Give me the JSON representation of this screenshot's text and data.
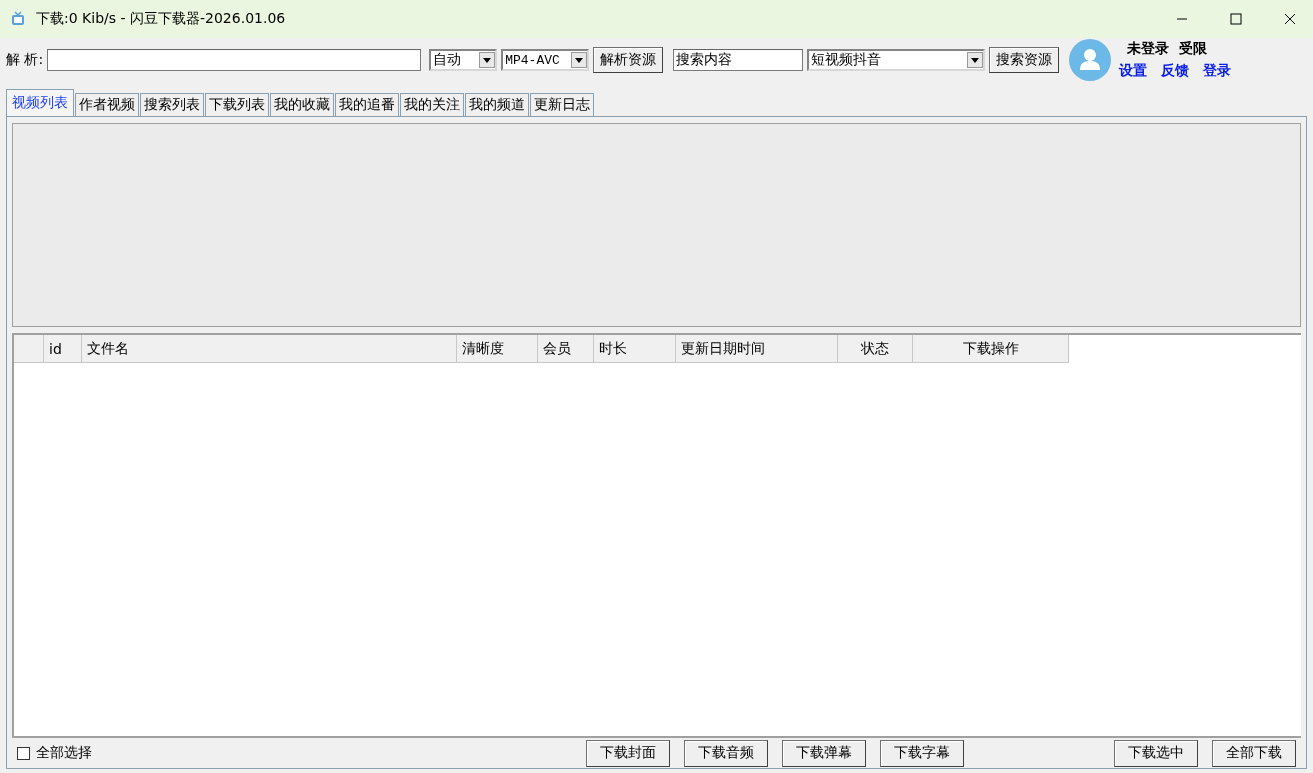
{
  "window": {
    "title": "下载:0 Kib/s - 闪豆下载器-2026.01.06"
  },
  "toolbar": {
    "parse_label": "解 析:",
    "quality_select": {
      "value": "自动"
    },
    "format_select": {
      "value": "MP4-AVC"
    },
    "parse_button": "解析资源",
    "search_field": {
      "value": "搜索内容"
    },
    "source_select": {
      "value": "短视频抖音"
    },
    "search_button": "搜索资源"
  },
  "user": {
    "status": "未登录",
    "permission": "受限",
    "links": [
      "设置",
      "反馈",
      "登录"
    ]
  },
  "tabs": [
    {
      "label": "视频列表",
      "selected": true
    },
    {
      "label": "作者视频",
      "selected": false
    },
    {
      "label": "搜索列表",
      "selected": false
    },
    {
      "label": "下载列表",
      "selected": false
    },
    {
      "label": "我的收藏",
      "selected": false
    },
    {
      "label": "我的追番",
      "selected": false
    },
    {
      "label": "我的关注",
      "selected": false
    },
    {
      "label": "我的频道",
      "selected": false
    },
    {
      "label": "更新日志",
      "selected": false
    }
  ],
  "table": {
    "columns": [
      "id",
      "文件名",
      "清晰度",
      "会员",
      "时长",
      "更新日期时间",
      "状态",
      "下载操作"
    ]
  },
  "footer": {
    "select_all": {
      "label": "全部选择",
      "checked": false
    },
    "buttons_middle": [
      "下载封面",
      "下载音频",
      "下载弹幕",
      "下载字幕"
    ],
    "buttons_right": [
      "下载选中",
      "全部下载"
    ]
  }
}
